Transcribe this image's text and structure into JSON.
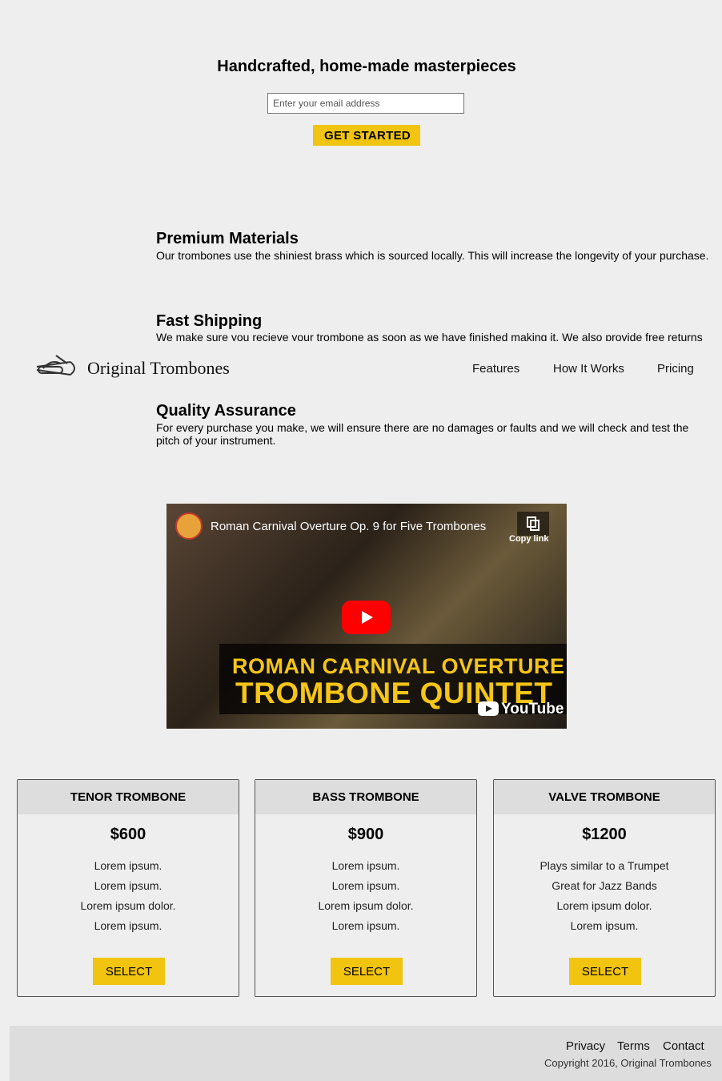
{
  "hero": {
    "title": "Handcrafted, home-made masterpieces",
    "email_placeholder": "Enter your email address",
    "cta_label": "GET STARTED"
  },
  "header": {
    "brand": "Original Trombones",
    "logo_icon": "trombone-icon",
    "nav": [
      "Features",
      "How It Works",
      "Pricing"
    ]
  },
  "features": [
    {
      "title": "Premium Materials",
      "text": "Our trombones use the shiniest brass which is sourced locally. This will increase the longevity of your purchase."
    },
    {
      "title": "Fast Shipping",
      "text": "We make sure you recieve your trombone as soon as we have finished making it. We also provide free returns"
    },
    {
      "title": "Quality Assurance",
      "text_line1": "For every purchase you make, we will ensure there are no damages or faults and we will check and test the",
      "text_line2": "pitch of your instrument."
    }
  ],
  "video": {
    "title": "Roman Carnival Overture Op. 9 for Five Trombones",
    "copy_link": "Copy link",
    "banner_line1": "ROMAN CARNIVAL OVERTURE",
    "banner_line2": "TROMBONE QUINTET",
    "platform": "YouTube"
  },
  "pricing": [
    {
      "name": "TENOR TROMBONE",
      "price": "$600",
      "lines": [
        "Lorem ipsum.",
        "Lorem ipsum.",
        "Lorem ipsum dolor.",
        "Lorem ipsum."
      ],
      "button": "SELECT"
    },
    {
      "name": "BASS TROMBONE",
      "price": "$900",
      "lines": [
        "Lorem ipsum.",
        "Lorem ipsum.",
        "Lorem ipsum dolor.",
        "Lorem ipsum."
      ],
      "button": "SELECT"
    },
    {
      "name": "VALVE TROMBONE",
      "price": "$1200",
      "lines": [
        "Plays similar to a Trumpet",
        "Great for Jazz Bands",
        "Lorem ipsum dolor.",
        "Lorem ipsum."
      ],
      "button": "SELECT"
    }
  ],
  "footer": {
    "links": [
      "Privacy",
      "Terms",
      "Contact"
    ],
    "copyright": "Copyright 2016, Original Trombones"
  },
  "colors": {
    "accent": "#f1c40f",
    "background": "#eeeeee",
    "panel": "#dddddd"
  }
}
